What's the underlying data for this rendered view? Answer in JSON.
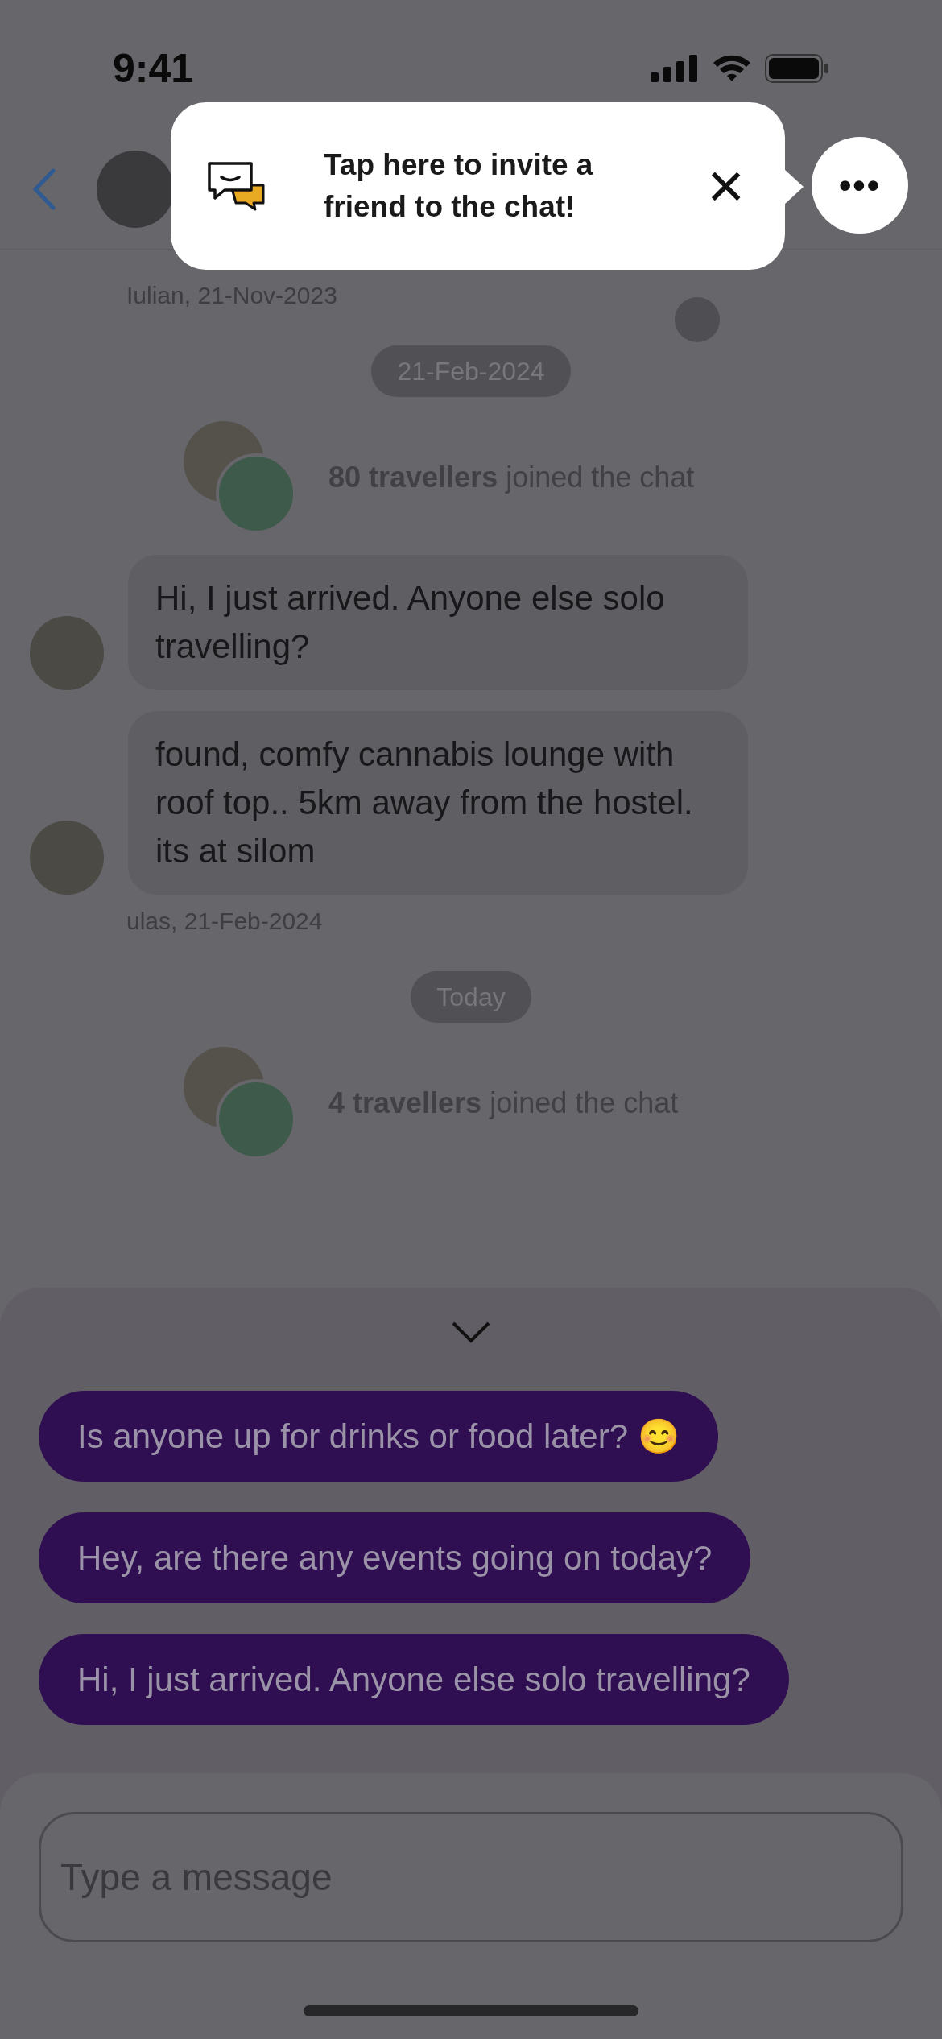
{
  "status_bar": {
    "time": "9:41"
  },
  "header": {
    "more_button": "•••"
  },
  "tooltip": {
    "text": "Tap here to invite a friend to the chat!",
    "close": "×"
  },
  "feed": [
    {
      "kind": "meta",
      "text": "Iulian, 21-Nov-2023"
    },
    {
      "kind": "date",
      "text": "21-Feb-2024"
    },
    {
      "kind": "joined",
      "count": "80 travellers",
      "text": "joined the chat"
    },
    {
      "kind": "message",
      "text": "Hi, I just arrived. Anyone else solo travelling?"
    },
    {
      "kind": "message",
      "text": "found, comfy cannabis lounge with roof top.. 5km away from the hostel. its at silom"
    },
    {
      "kind": "meta",
      "text": "ulas, 21-Feb-2024"
    },
    {
      "kind": "date",
      "text": "Today"
    },
    {
      "kind": "joined",
      "count": "4 travellers",
      "text": "joined the chat"
    }
  ],
  "suggestions": {
    "expanded": true,
    "items": [
      "Is anyone up for drinks or food later? 😊",
      "Hey, are there any events going on today?",
      "Hi, I just arrived. Anyone else solo travelling?"
    ]
  },
  "composer": {
    "placeholder": "Type a message"
  }
}
